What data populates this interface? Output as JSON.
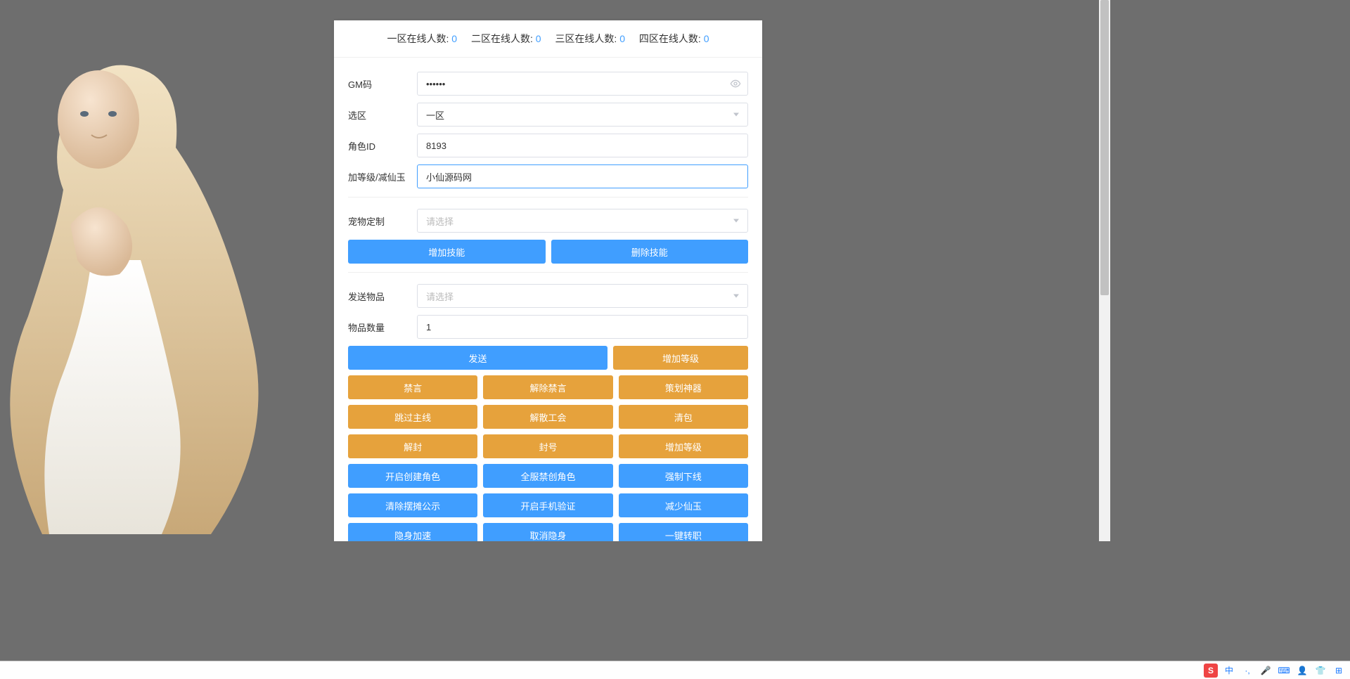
{
  "online": [
    {
      "label": "一区在线人数:",
      "count": 0
    },
    {
      "label": "二区在线人数:",
      "count": 0
    },
    {
      "label": "三区在线人数:",
      "count": 0
    },
    {
      "label": "四区在线人数:",
      "count": 0
    }
  ],
  "form": {
    "gm_label": "GM码",
    "gm_value": "••••••",
    "zone_label": "选区",
    "zone_value": "一区",
    "role_label": "角色ID",
    "role_value": "8193",
    "level_label": "加等级/减仙玉",
    "level_value": "小仙源码网",
    "pet_label": "宠物定制",
    "pet_placeholder": "请选择",
    "send_item_label": "发送物品",
    "send_item_placeholder": "请选择",
    "qty_label": "物品数量",
    "qty_value": "1"
  },
  "skill_buttons": {
    "add": "增加技能",
    "del": "删除技能"
  },
  "send_buttons": {
    "send": "发送",
    "add_level": "增加等级"
  },
  "grid_orange": [
    [
      "禁言",
      "解除禁言",
      "策划神器"
    ],
    [
      "跳过主线",
      "解散工会",
      "清包"
    ],
    [
      "解封",
      "封号",
      "增加等级"
    ]
  ],
  "grid_blue": [
    [
      "开启创建角色",
      "全服禁创角色",
      "强制下线"
    ],
    [
      "清除摆摊公示",
      "开启手机验证",
      "减少仙玉"
    ],
    [
      "隐身加速",
      "取消隐身",
      "一键转职"
    ]
  ],
  "taskbar": [
    "S",
    "中",
    "·,",
    "🎤",
    "⌨",
    "👤",
    "👕",
    "⊞"
  ]
}
